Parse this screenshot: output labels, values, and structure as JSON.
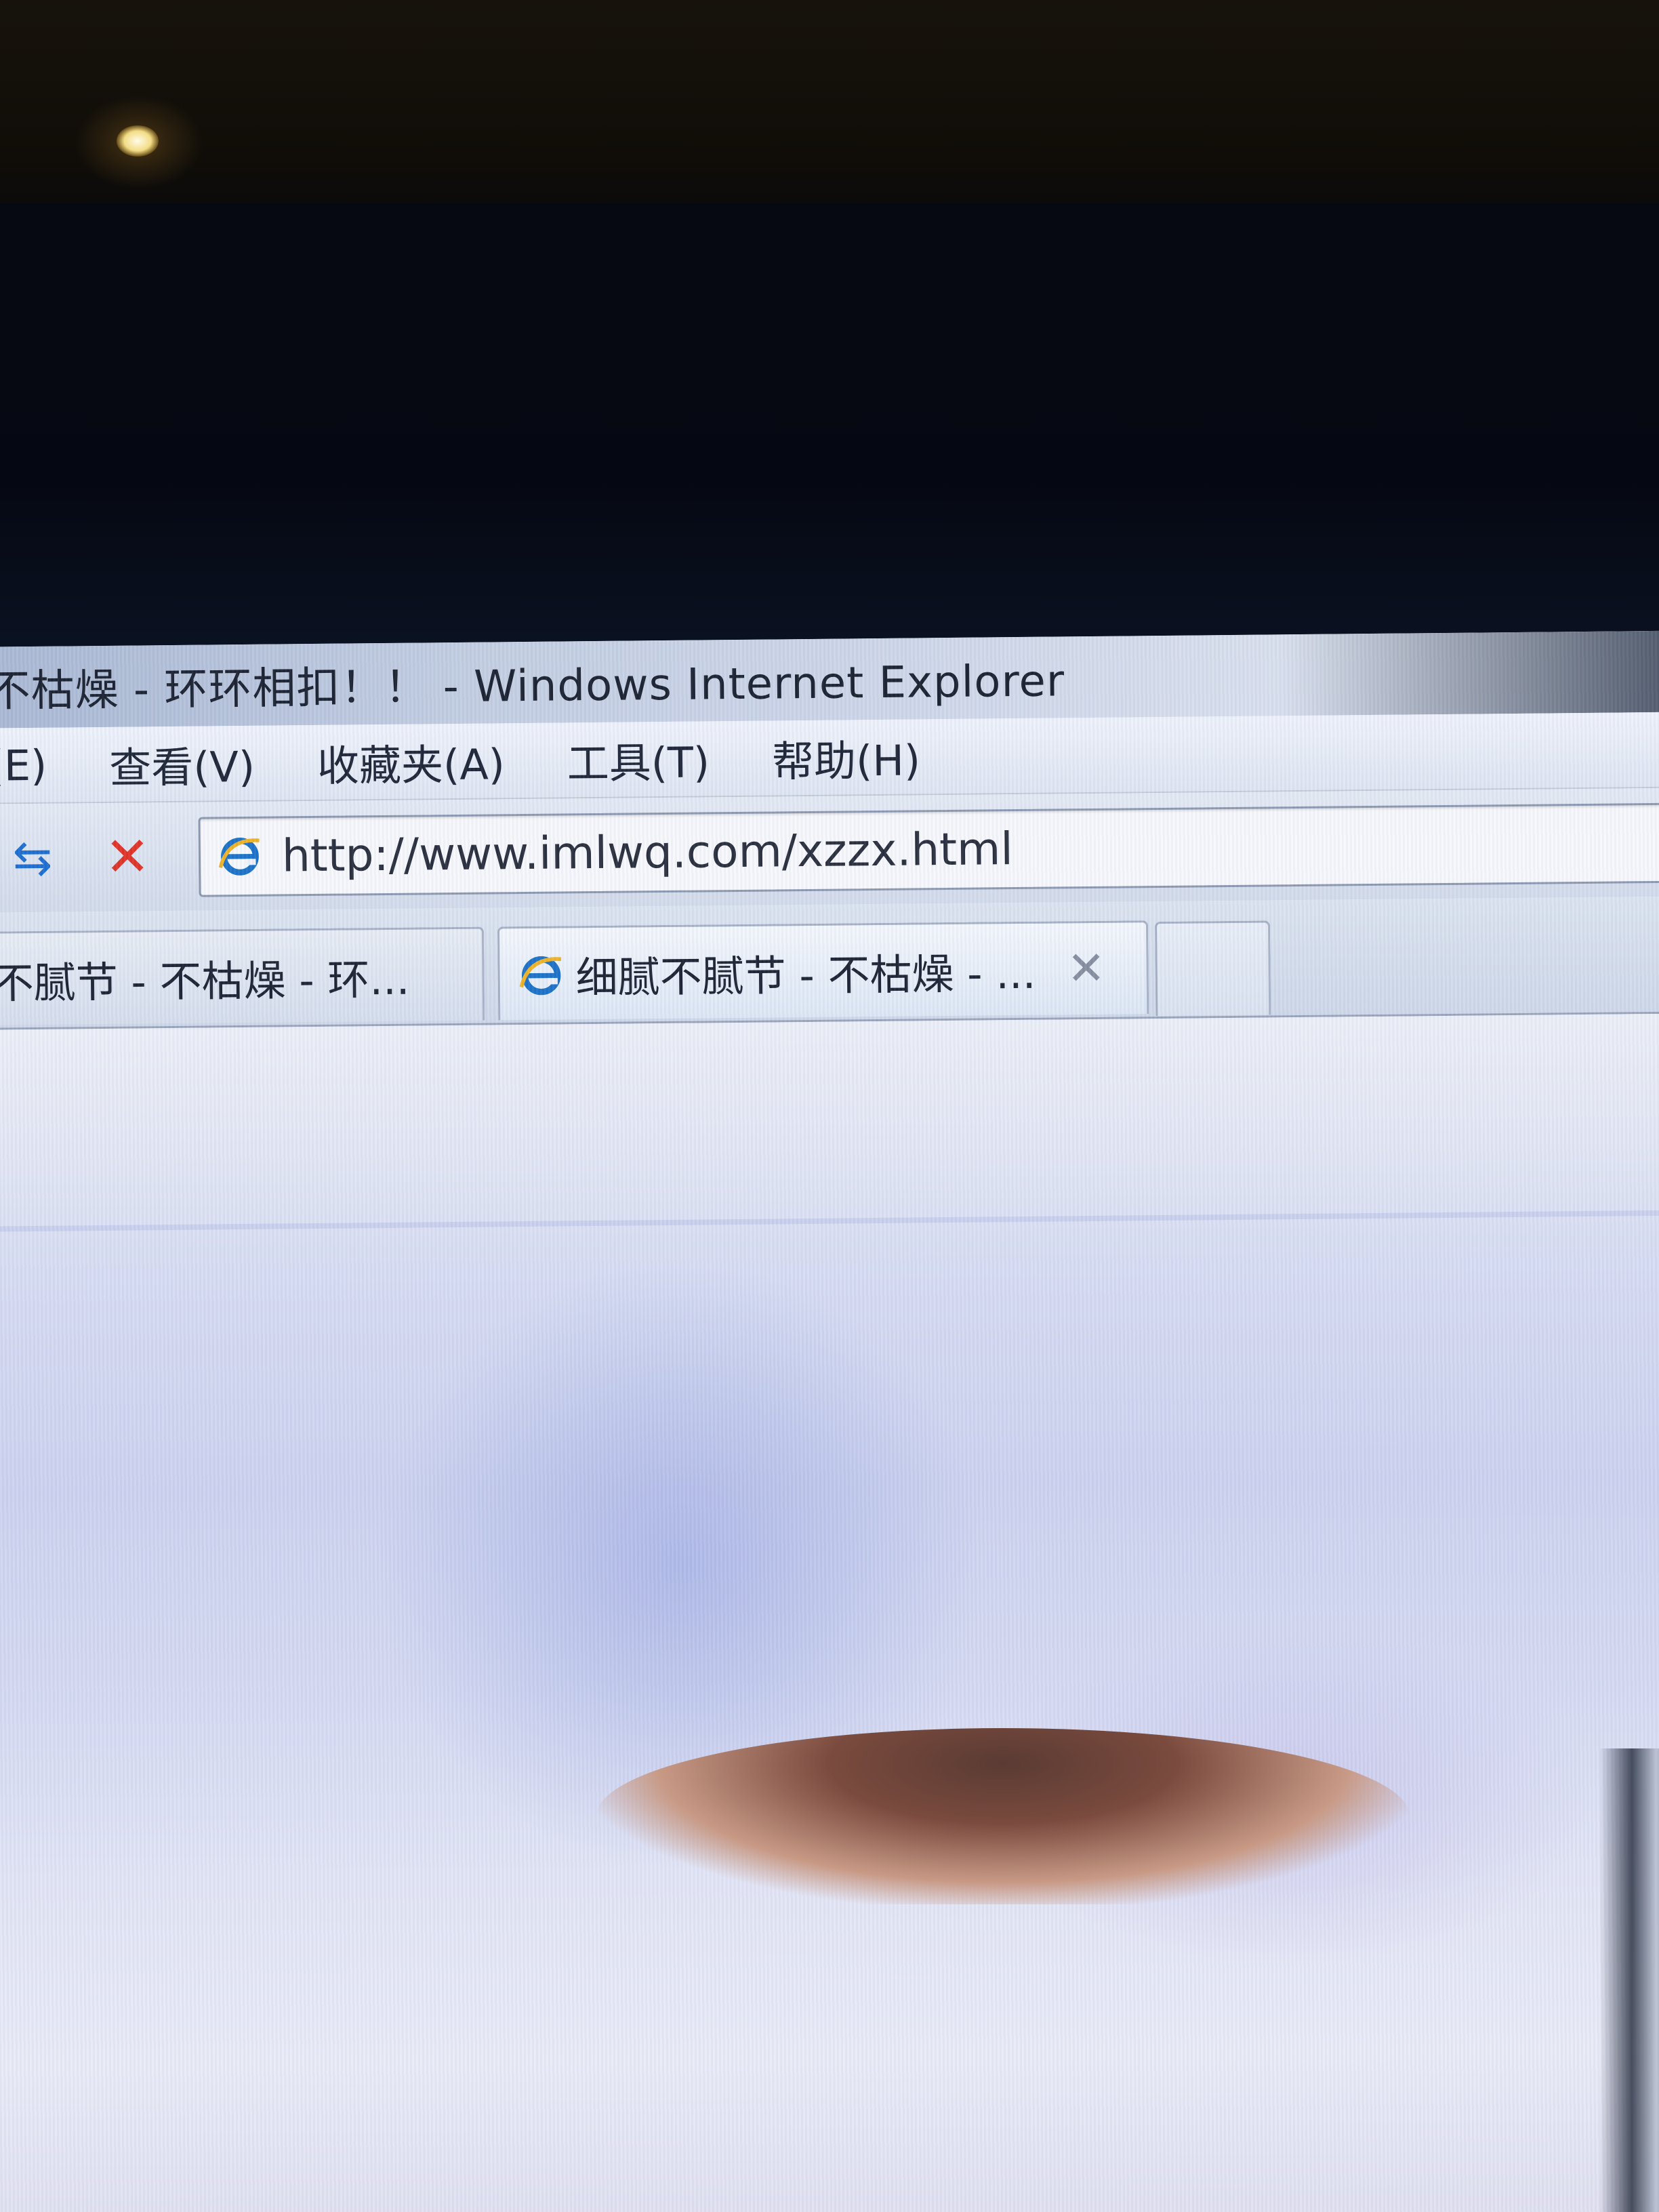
{
  "window": {
    "title": "不枯燥 - 环环相扣！！ - Windows Internet Explorer"
  },
  "menu": {
    "items": [
      {
        "label": "(E)"
      },
      {
        "label": "查看(V)"
      },
      {
        "label": "收藏夹(A)"
      },
      {
        "label": "工具(T)"
      },
      {
        "label": "帮助(H)"
      }
    ]
  },
  "address": {
    "url": "http://www.imlwq.com/xzzx.html"
  },
  "tabs": [
    {
      "label": "不腻节 - 不枯燥 - 环...",
      "active": false
    },
    {
      "label": "细腻不腻节 - 不枯燥 - ...",
      "active": true
    }
  ],
  "icons": {
    "refresh": "refresh-icon",
    "stop": "stop-icon",
    "page": "ie-page-icon",
    "tab_close": "close-icon"
  },
  "colors": {
    "stop": "#e0352a",
    "refresh": "#1f6fd1",
    "ie_blue": "#1e74c8",
    "ie_gold": "#f0b429"
  }
}
